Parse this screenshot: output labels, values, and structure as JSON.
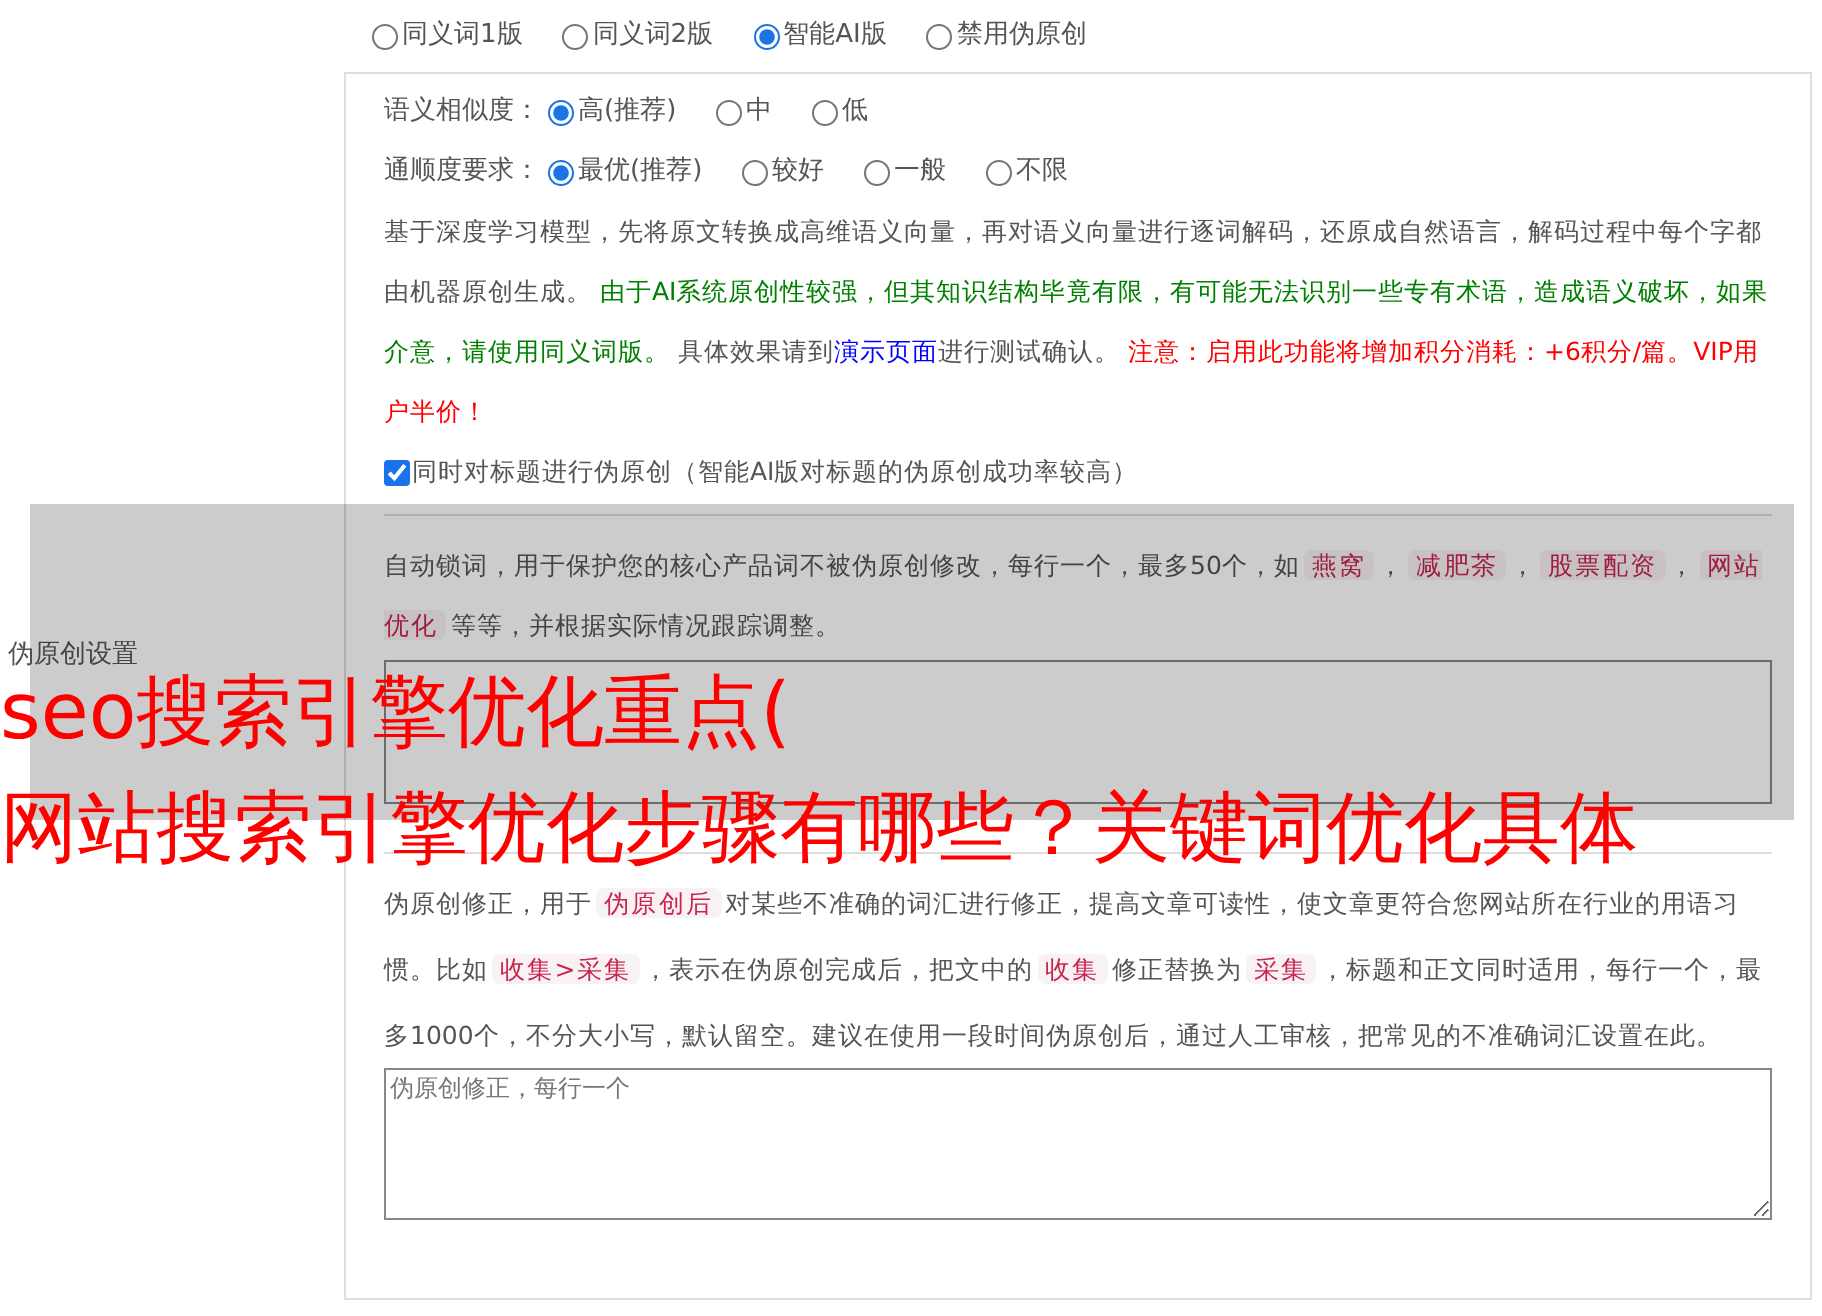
{
  "section_label": "伪原创设置",
  "modes": [
    {
      "label": "同义词1版",
      "selected": false
    },
    {
      "label": "同义词2版",
      "selected": false
    },
    {
      "label": "智能AI版",
      "selected": true
    },
    {
      "label": "禁用伪原创",
      "selected": false
    }
  ],
  "similarity": {
    "label": "语义相似度：",
    "options": [
      {
        "label": "高(推荐)",
        "selected": true
      },
      {
        "label": "中",
        "selected": false
      },
      {
        "label": "低",
        "selected": false
      }
    ]
  },
  "fluency": {
    "label": "通顺度要求：",
    "options": [
      {
        "label": "最优(推荐)",
        "selected": true
      },
      {
        "label": "较好",
        "selected": false
      },
      {
        "label": "一般",
        "selected": false
      },
      {
        "label": "不限",
        "selected": false
      }
    ]
  },
  "ai_description": [
    {
      "kind": "plain",
      "text": "基于深度学习模型，先将原文转换成高维语义向量，再对语义向量进行逐词解码，还原成自然语言，解码过程中每个字都由机器原创生成。 "
    },
    {
      "kind": "green",
      "text": "由于AI系统原创性较强，但其知识结构毕竟有限，有可能无法识别一些专有术语，造成语义破坏，如果介意，请使用同义词版。"
    },
    {
      "kind": "plain",
      "text": " 具体效果请到"
    },
    {
      "kind": "link",
      "text": "演示页面"
    },
    {
      "kind": "plain",
      "text": "进行测试确认。 "
    },
    {
      "kind": "red",
      "text": "注意：启用此功能将增加积分消耗：+6积分/篇。VIP用户半价！"
    }
  ],
  "title_option": {
    "label": "同时对标题进行伪原创（智能AI版对标题的伪原创成功率较高）",
    "checked": true
  },
  "lock_words": {
    "description": [
      {
        "kind": "plain",
        "text": "自动锁词，用于保护您的核心产品词不被伪原创修改，每行一个，最多50个，如"
      },
      {
        "kind": "tag",
        "text": "燕窝"
      },
      {
        "kind": "plain",
        "text": "，"
      },
      {
        "kind": "tag",
        "text": "减肥茶"
      },
      {
        "kind": "plain",
        "text": "，"
      },
      {
        "kind": "tag",
        "text": "股票配资"
      },
      {
        "kind": "plain",
        "text": "，"
      },
      {
        "kind": "tag",
        "text": "网站优化"
      },
      {
        "kind": "plain",
        "text": "等等，并根据实际情况跟踪调整。"
      }
    ]
  },
  "correction": {
    "description": [
      {
        "kind": "plain",
        "text": "伪原创修正，用于"
      },
      {
        "kind": "tag",
        "text": "伪原创后"
      },
      {
        "kind": "plain",
        "text": "对某些不准确的词汇进行修正，提高文章可读性，使文章更符合您网站所在行业的用语习惯。比如"
      },
      {
        "kind": "tag",
        "text": "收集>采集"
      },
      {
        "kind": "plain",
        "text": "，表示在伪原创完成后，把文中的"
      },
      {
        "kind": "tag",
        "text": "收集"
      },
      {
        "kind": "plain",
        "text": "修正替换为"
      },
      {
        "kind": "tag",
        "text": "采集"
      },
      {
        "kind": "plain",
        "text": "，标题和正文同时适用，每行一个，最多1000个，不分大小写，默认留空。建议在使用一段时间伪原创后，通过人工审核，把常见的不准确词汇设置在此。"
      }
    ],
    "placeholder": "伪原创修正，每行一个"
  },
  "overlay": {
    "lines": [
      "seo搜索引擎优化重点(",
      "网站搜索引擎优化步骤有哪些？关键词优化具体"
    ]
  }
}
